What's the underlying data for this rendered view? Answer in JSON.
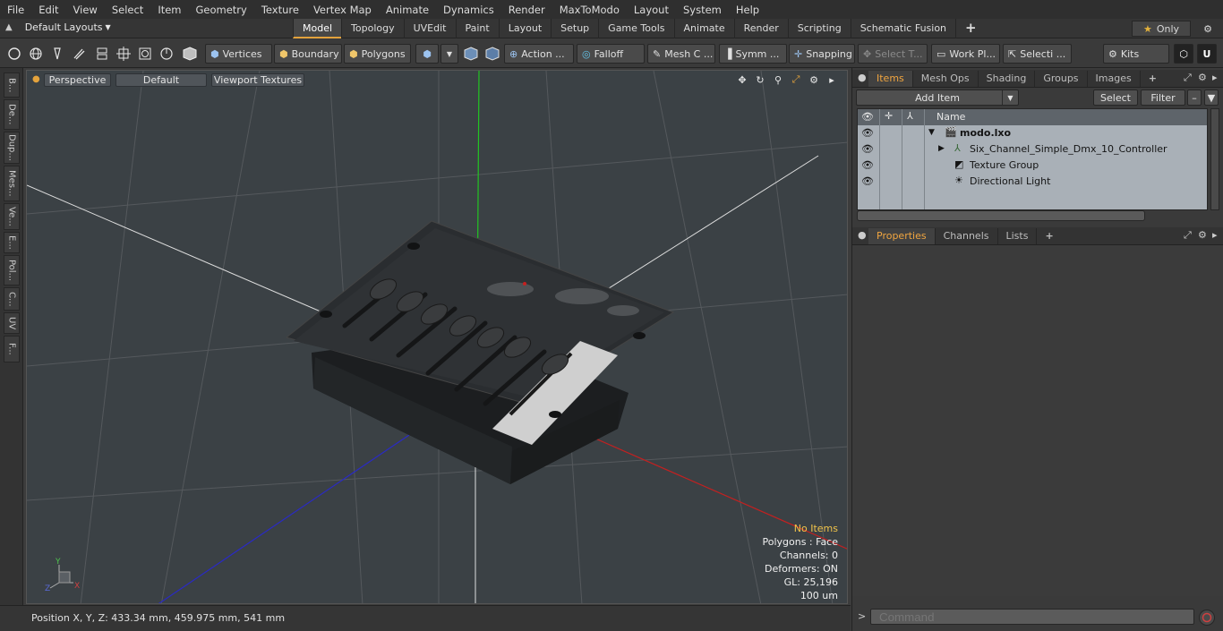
{
  "menu": [
    "File",
    "Edit",
    "View",
    "Select",
    "Item",
    "Geometry",
    "Texture",
    "Vertex Map",
    "Animate",
    "Dynamics",
    "Render",
    "MaxToModo",
    "Layout",
    "System",
    "Help"
  ],
  "layout": {
    "selector": "Default Layouts",
    "tabs": [
      "Model",
      "Topology",
      "UVEdit",
      "Paint",
      "Layout",
      "Setup",
      "Game Tools",
      "Animate",
      "Render",
      "Scripting",
      "Schematic Fusion"
    ],
    "active_tab": "Model",
    "only_label": "Only"
  },
  "toolbar": {
    "vertices": "Vertices",
    "boundary": "Boundary",
    "polygons": "Polygons",
    "action": "Action ...",
    "falloff": "Falloff",
    "mesh": "Mesh C ...",
    "symm": "Symm ...",
    "snapping": "Snapping",
    "select_t": "Select T...",
    "work": "Work Pl...",
    "selecti": "Selecti ...",
    "kits": "Kits"
  },
  "left_tabs": [
    "B...",
    "De...",
    "Dup...",
    "Mes...",
    "Ve...",
    "E...",
    "Pol...",
    "C...",
    "UV",
    "F..."
  ],
  "viewport": {
    "view": "Perspective",
    "shading": "Default",
    "textures": "Viewport Textures",
    "info": [
      "No Items",
      "Polygons : Face",
      "Channels: 0",
      "Deformers: ON",
      "GL: 25,196",
      "100 um"
    ]
  },
  "status": {
    "position": "Position X, Y, Z:   433.34 mm, 459.975 mm, 541 mm"
  },
  "items_panel": {
    "tabs": [
      "Items",
      "Mesh Ops",
      "Shading",
      "Groups",
      "Images"
    ],
    "active_tab": "Items",
    "add_item": "Add Item",
    "select": "Select",
    "filter": "Filter",
    "column_name": "Name",
    "tree": [
      {
        "label": "modo.lxo",
        "depth": 0
      },
      {
        "label": "Six_Channel_Simple_Dmx_10_Controller",
        "depth": 1
      },
      {
        "label": "Texture Group",
        "depth": 1
      },
      {
        "label": "Directional Light",
        "depth": 1
      }
    ]
  },
  "props_panel": {
    "tabs": [
      "Properties",
      "Channels",
      "Lists"
    ],
    "active_tab": "Properties"
  },
  "command": {
    "placeholder": "Command"
  },
  "colors": {
    "accent": "#e3a23c",
    "info_highlight": "#f1c44b",
    "x_axis": "#c42020",
    "y_axis": "#22c422",
    "z_axis": "#2a2ac4"
  }
}
